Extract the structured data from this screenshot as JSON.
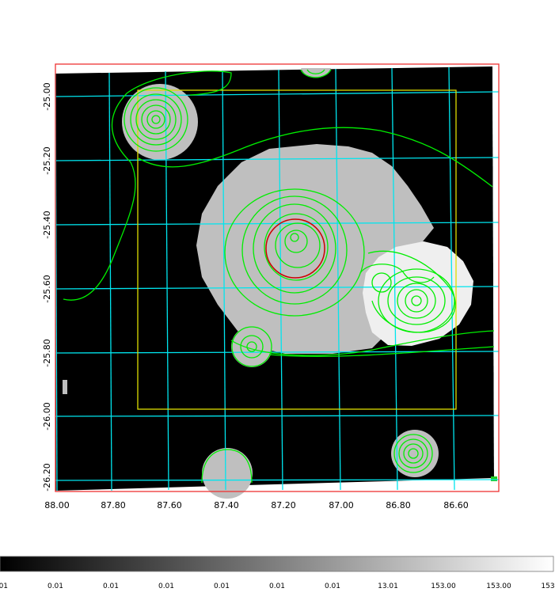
{
  "image": {
    "type": "sky-map",
    "colormap": "grayscale",
    "grid_color": "#00e5ee",
    "contour_color": "#00ee00",
    "frame_color": "#ee3333",
    "box_color": "#dddd00",
    "region_color": "#cc0000"
  },
  "x_axis": {
    "ticks": [
      "88.00",
      "87.80",
      "87.60",
      "87.40",
      "87.20",
      "87.00",
      "86.80",
      "86.60"
    ]
  },
  "y_axis": {
    "ticks": [
      "-25.00",
      "-25.20",
      "-25.40",
      "-25.60",
      "-25.80",
      "-26.00",
      "-26.20"
    ]
  },
  "colorbar": {
    "labels": [
      "0.01",
      "0.01",
      "0.01",
      "0.01",
      "0.01",
      "0.01",
      "0.01",
      "13.01",
      "153.00",
      "153.00",
      "153"
    ]
  }
}
